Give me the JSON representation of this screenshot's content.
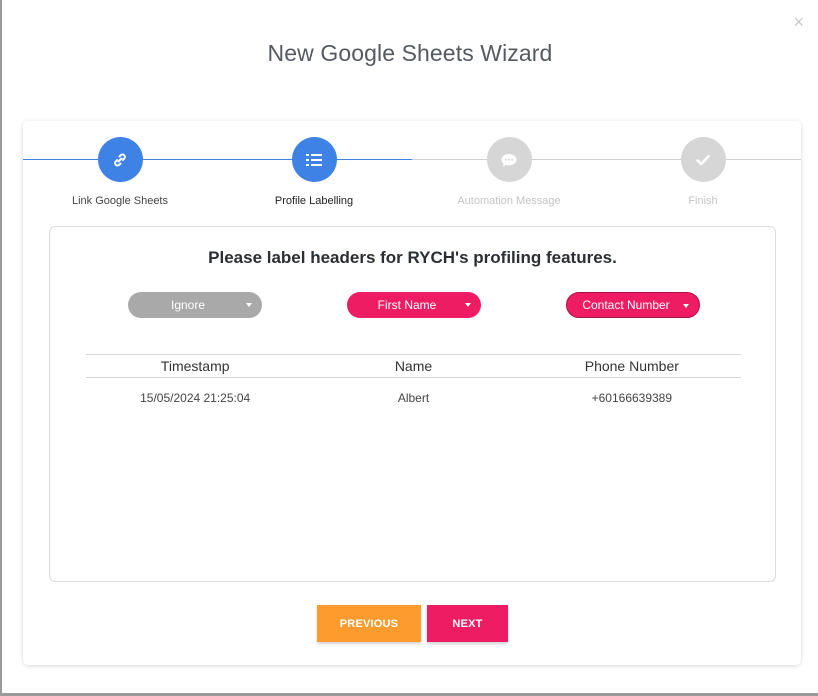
{
  "dialog": {
    "title": "New Google Sheets Wizard",
    "close_symbol": "×"
  },
  "stepper": {
    "steps": [
      {
        "label": "Link Google Sheets",
        "icon": "link-icon",
        "state": "done"
      },
      {
        "label": "Profile Labelling",
        "icon": "list-icon",
        "state": "current"
      },
      {
        "label": "Automation Message",
        "icon": "chat-bubble-icon",
        "state": "pending"
      },
      {
        "label": "Finish",
        "icon": "check-icon",
        "state": "pending"
      }
    ]
  },
  "labelling": {
    "heading": "Please label headers for RYCH's profiling features.",
    "dropdowns": [
      {
        "value": "Ignore",
        "color": "#a9a9a9"
      },
      {
        "value": "First Name",
        "color": "#ee1c63"
      },
      {
        "value": "Contact Number",
        "color": "#ee1c63"
      }
    ],
    "table": {
      "headers": [
        "Timestamp",
        "Name",
        "Phone Number"
      ],
      "rows": [
        [
          "15/05/2024 21:25:04",
          "Albert",
          "+60166639389"
        ]
      ]
    }
  },
  "footer": {
    "previous_label": "PREVIOUS",
    "next_label": "NEXT"
  },
  "colors": {
    "accent_blue": "#3d82e4",
    "accent_pink": "#ee1c63",
    "accent_orange": "#fe9b2f",
    "inactive_grey": "#d6d6d6"
  }
}
